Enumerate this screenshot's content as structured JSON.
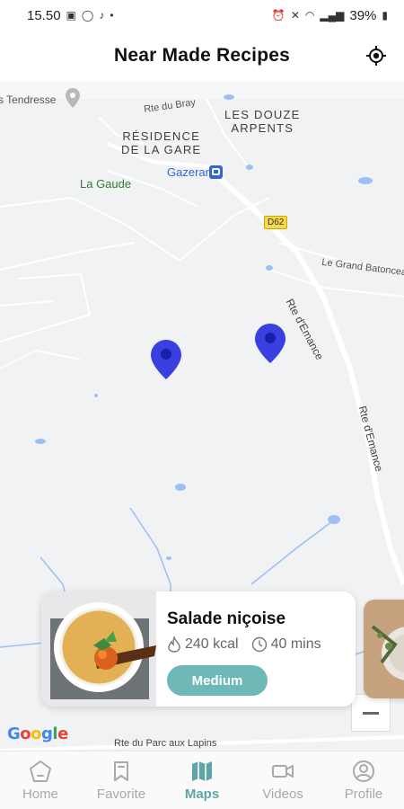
{
  "status_bar": {
    "time": "15.50",
    "battery": "39%"
  },
  "header": {
    "title": "Near Made Recipes"
  },
  "map": {
    "labels": {
      "tendresse": "s Tendresse",
      "rte_bray": "Rte du Bray",
      "douze_arpents_1": "LES DOUZE",
      "douze_arpents_2": "ARPENTS",
      "residence_1": "RÉSIDENCE",
      "residence_2": "DE LA GARE",
      "gazeran": "Gazeran",
      "la_gaude": "La Gaude",
      "d62": "D62",
      "grand_batonceau": "Le Grand Batonceau",
      "rte_emance_1": "Rte d'Emance",
      "rte_emance_2": "Rte d'Emance",
      "parc_lapins": "Rte du Parc aux Lapins"
    },
    "google": [
      "G",
      "o",
      "o",
      "g",
      "l",
      "e"
    ],
    "google_colors": [
      "#4285F4",
      "#EA4335",
      "#FBBC05",
      "#4285F4",
      "#34A853",
      "#EA4335"
    ]
  },
  "recipe_card": {
    "title": "Salade niçoise",
    "calories": "240 kcal",
    "time": "40 mins",
    "difficulty": "Medium"
  },
  "nav": {
    "items": [
      {
        "label": "Home",
        "icon": "home-icon"
      },
      {
        "label": "Favorite",
        "icon": "bookmark-icon"
      },
      {
        "label": "Maps",
        "icon": "map-icon"
      },
      {
        "label": "Videos",
        "icon": "video-icon"
      },
      {
        "label": "Profile",
        "icon": "profile-icon"
      }
    ]
  }
}
